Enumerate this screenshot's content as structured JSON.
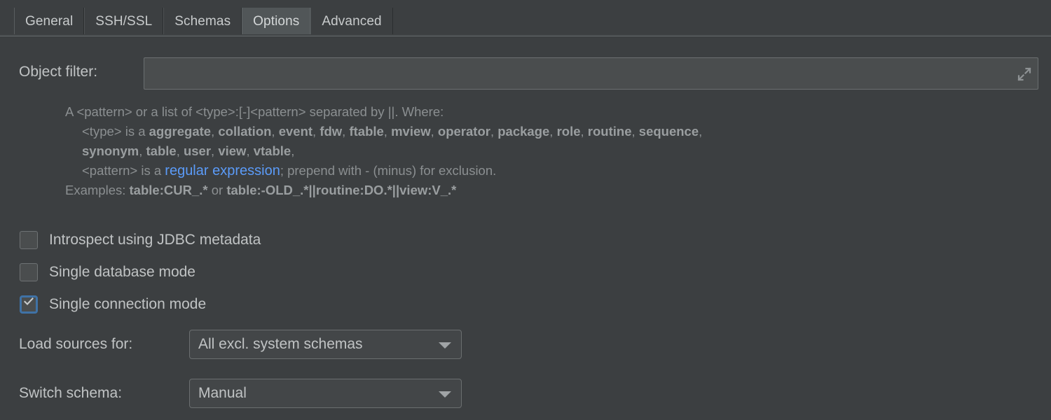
{
  "tabs": [
    {
      "label": "General",
      "selected": false
    },
    {
      "label": "SSH/SSL",
      "selected": false
    },
    {
      "label": "Schemas",
      "selected": false
    },
    {
      "label": "Options",
      "selected": true
    },
    {
      "label": "Advanced",
      "selected": false
    }
  ],
  "object_filter": {
    "label": "Object filter:",
    "value": "",
    "placeholder": "",
    "expand_icon": "expand-arrows-icon"
  },
  "help": {
    "line1": "A <pattern> or a list of <type>:[-]<pattern> separated by ||. Where:",
    "line2_prefix": "<type> is a ",
    "line2_types": [
      "aggregate",
      "collation",
      "event",
      "fdw",
      "ftable",
      "mview",
      "operator",
      "package",
      "role",
      "routine",
      "sequence"
    ],
    "line3_types": [
      "synonym",
      "table",
      "user",
      "view",
      "vtable"
    ],
    "line4_prefix": "<pattern> is a ",
    "line4_link": "regular expression",
    "line4_suffix": "; prepend with - (minus) for exclusion.",
    "line5_prefix": "Examples: ",
    "line5_example1": "table:CUR_.*",
    "line5_middle": " or ",
    "line5_example2": "table:-OLD_.*||routine:DO.*||view:V_.*"
  },
  "checkboxes": [
    {
      "label": "Introspect using JDBC metadata",
      "checked": false,
      "focused": false
    },
    {
      "label": "Single database mode",
      "checked": false,
      "focused": false
    },
    {
      "label": "Single connection mode",
      "checked": true,
      "focused": true
    }
  ],
  "selects": [
    {
      "label": "Load sources for:",
      "value": "All excl. system schemas",
      "icon": "chevron-down-icon"
    },
    {
      "label": "Switch schema:",
      "value": "Manual",
      "icon": "chevron-down-icon"
    }
  ],
  "colors": {
    "panel_bg": "#3c3f41",
    "tab_selected_bg": "#515658",
    "text": "#c0c3c4",
    "help_text": "#8b8f91",
    "link": "#5b9bf8",
    "checkbox_focus": "#3f72a6",
    "field_bg": "#4a4d4e",
    "border": "#6b6f70"
  }
}
